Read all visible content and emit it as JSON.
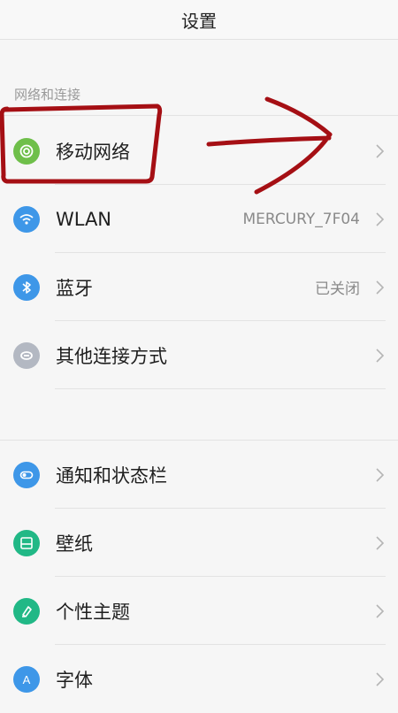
{
  "header": {
    "title": "设置"
  },
  "section_network": {
    "label": "网络和连接",
    "items": [
      {
        "label": "移动网络",
        "value": "",
        "icon": "mobile-network-icon",
        "color": "#6fbf4a"
      },
      {
        "label": "WLAN",
        "value": "MERCURY_7F04",
        "icon": "wifi-icon",
        "color": "#3e97e8"
      },
      {
        "label": "蓝牙",
        "value": "已关闭",
        "icon": "bluetooth-icon",
        "color": "#3e97e8"
      },
      {
        "label": "其他连接方式",
        "value": "",
        "icon": "link-icon",
        "color": "#b3b8c2"
      }
    ]
  },
  "section_display": {
    "items": [
      {
        "label": "通知和状态栏",
        "value": "",
        "icon": "toggle-icon",
        "color": "#3e97e8"
      },
      {
        "label": "壁纸",
        "value": "",
        "icon": "wallpaper-icon",
        "color": "#21b886"
      },
      {
        "label": "个性主题",
        "value": "",
        "icon": "theme-brush-icon",
        "color": "#21b886"
      },
      {
        "label": "字体",
        "value": "",
        "icon": "font-icon",
        "color": "#3e97e8"
      }
    ]
  },
  "annotation_color": "#a50f14"
}
